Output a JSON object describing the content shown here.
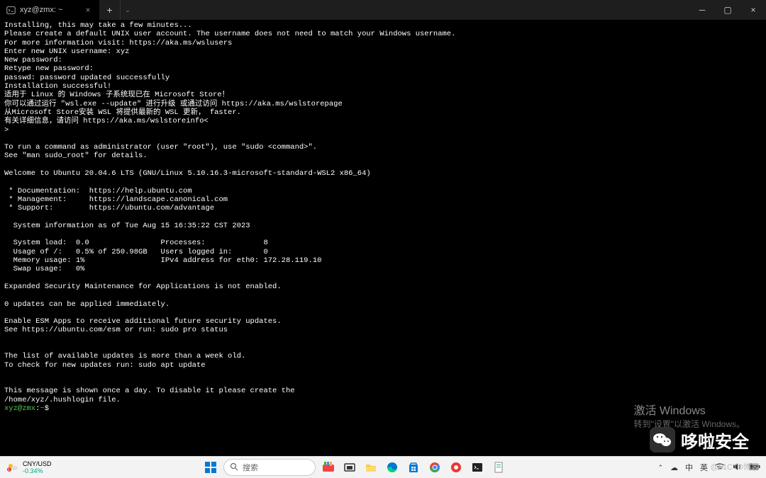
{
  "titlebar": {
    "tab_title": "xyz@zmx: ~",
    "close": "×",
    "plus": "+",
    "dropdown": "⌄",
    "minimize": "─",
    "maximize": "▢",
    "winclose": "×"
  },
  "terminal": {
    "lines": [
      "Installing, this may take a few minutes...",
      "Please create a default UNIX user account. The username does not need to match your Windows username.",
      "For more information visit: https://aka.ms/wslusers",
      "Enter new UNIX username: xyz",
      "New password:",
      "Retype new password:",
      "passwd: password updated successfully",
      "Installation successful!",
      "适用于 Linux 的 Windows 子系统现已在 Microsoft Store！",
      "你可以通过运行 \"wsl.exe --update\" 进行升级 或通过访问 https://aka.ms/wslstorepage",
      "从Microsoft Store安装 WSL 将提供最新的 WSL 更新， faster.",
      "有关详细信息，请访问 https://aka.ms/wslstoreinfo<",
      ">",
      "",
      "To run a command as administrator (user \"root\"), use \"sudo <command>\".",
      "See \"man sudo_root\" for details.",
      "",
      "Welcome to Ubuntu 20.04.6 LTS (GNU/Linux 5.10.16.3-microsoft-standard-WSL2 x86_64)",
      "",
      " * Documentation:  https://help.ubuntu.com",
      " * Management:     https://landscape.canonical.com",
      " * Support:        https://ubuntu.com/advantage",
      "",
      "  System information as of Tue Aug 15 16:35:22 CST 2023",
      "",
      "  System load:  0.0                Processes:             8",
      "  Usage of /:   0.5% of 250.98GB   Users logged in:       0",
      "  Memory usage: 1%                 IPv4 address for eth0: 172.28.119.10",
      "  Swap usage:   0%",
      "",
      "Expanded Security Maintenance for Applications is not enabled.",
      "",
      "0 updates can be applied immediately.",
      "",
      "Enable ESM Apps to receive additional future security updates.",
      "See https://ubuntu.com/esm or run: sudo pro status",
      "",
      "",
      "The list of available updates is more than a week old.",
      "To check for new updates run: sudo apt update",
      "",
      "",
      "This message is shown once a day. To disable it please create the",
      "/home/xyz/.hushlogin file."
    ],
    "prompt_user": "xyz@zmx",
    "prompt_sep": ":",
    "prompt_path": "~",
    "prompt_end": "$"
  },
  "watermark": {
    "line1": "激活 Windows",
    "line2": "转到\"设置\"以激活 Windows。"
  },
  "brand": {
    "text": "哆啦安全"
  },
  "taskbar": {
    "stock_label": "CNY/USD",
    "stock_change": "-0.34%",
    "search_placeholder": "搜索",
    "ime": "中",
    "lang": "英",
    "blog": "@51CTO博客"
  }
}
